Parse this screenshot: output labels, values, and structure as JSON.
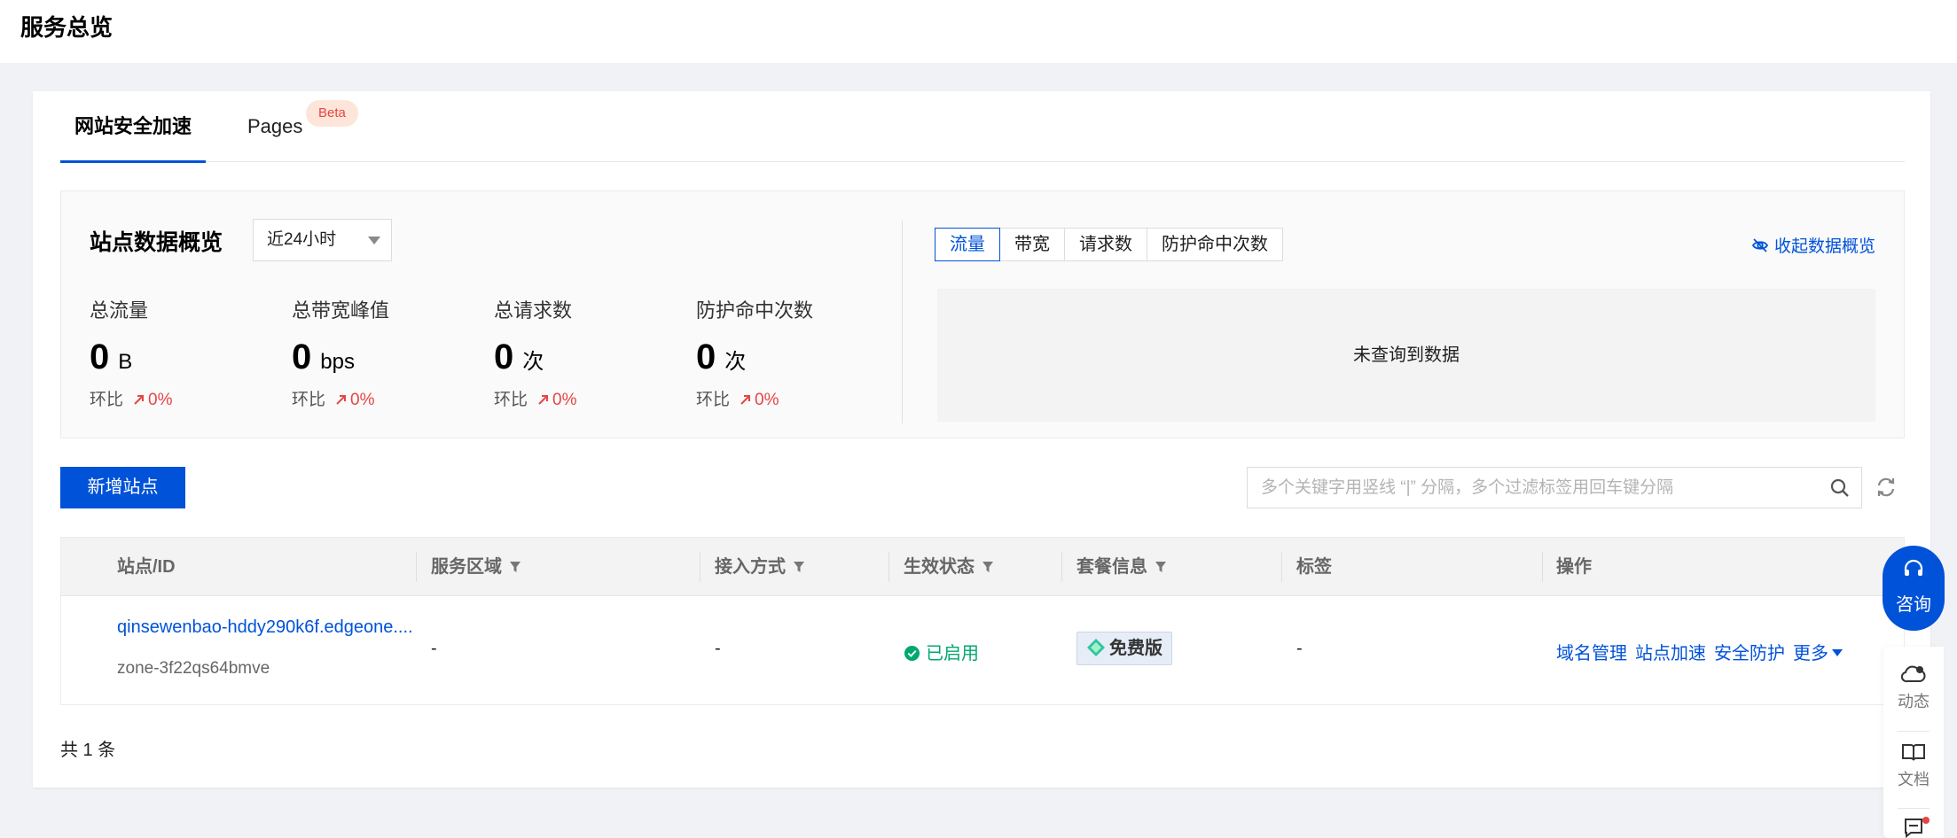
{
  "page": {
    "title": "服务总览"
  },
  "tabs": [
    {
      "label": "网站安全加速",
      "active": true
    },
    {
      "label": "Pages",
      "badge": "Beta",
      "active": false
    }
  ],
  "overview": {
    "title": "站点数据概览",
    "range": "近24小时",
    "metrics": [
      {
        "label": "总流量",
        "value": "0",
        "unit": "B",
        "ratio_label": "环比",
        "ratio": "0%"
      },
      {
        "label": "总带宽峰值",
        "value": "0",
        "unit": "bps",
        "ratio_label": "环比",
        "ratio": "0%"
      },
      {
        "label": "总请求数",
        "value": "0",
        "unit": "次",
        "ratio_label": "环比",
        "ratio": "0%"
      },
      {
        "label": "防护命中次数",
        "value": "0",
        "unit": "次",
        "ratio_label": "环比",
        "ratio": "0%"
      }
    ],
    "chart_tabs": [
      "流量",
      "带宽",
      "请求数",
      "防护命中次数"
    ],
    "active_chart_tab": "流量",
    "collapse_label": "收起数据概览",
    "no_data": "未查询到数据"
  },
  "toolbar": {
    "add_site": "新增站点",
    "search_placeholder": "多个关键字用竖线 “|” 分隔，多个过滤标签用回车键分隔"
  },
  "table": {
    "columns": [
      "站点/ID",
      "服务区域",
      "接入方式",
      "生效状态",
      "套餐信息",
      "标签",
      "操作"
    ],
    "rows": [
      {
        "site": "qinsewenbao-hddy290k6f.edgeone....",
        "zone_id": "zone-3f22qs64bmve",
        "region": "-",
        "access": "-",
        "status": "已启用",
        "plan": "免费版",
        "tags": "-",
        "actions": [
          "域名管理",
          "站点加速",
          "安全防护",
          "更多"
        ]
      }
    ],
    "total": "共 1 条"
  },
  "float": {
    "consult": "咨询",
    "items": [
      "动态",
      "文档"
    ]
  },
  "colors": {
    "primary": "#0052d9",
    "danger": "#e54545",
    "success": "#00a870"
  }
}
